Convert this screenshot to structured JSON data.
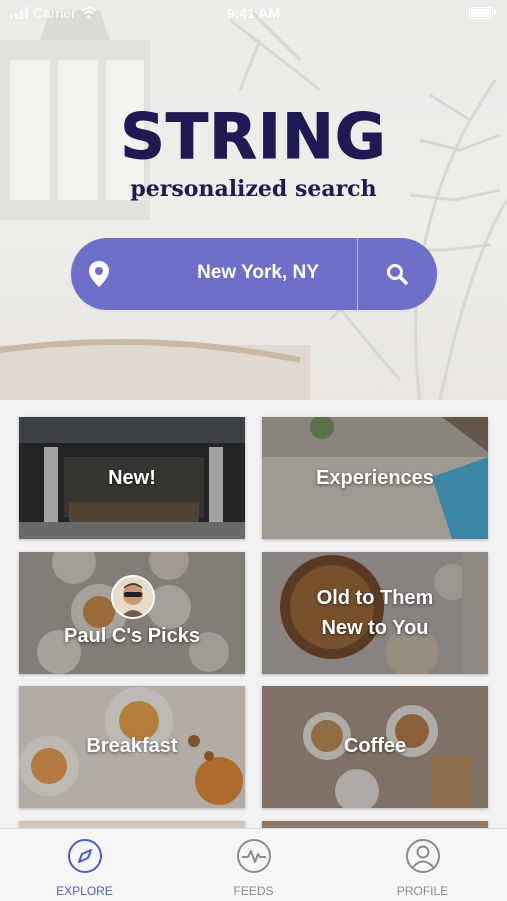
{
  "status_bar": {
    "carrier": "Carrier",
    "time": "9:41 AM"
  },
  "app": {
    "title": "STRING",
    "subtitle": "personalized search"
  },
  "search": {
    "location": "New York, NY",
    "pin_icon": "location-pin-icon",
    "search_icon": "magnifier-icon"
  },
  "colors": {
    "accent": "#6d6fc8",
    "title": "#1f1a52",
    "tab_active": "#4d5bd0",
    "tab_inactive": "#8c8c90"
  },
  "tiles": [
    {
      "label": "New!"
    },
    {
      "label": "Experiences"
    },
    {
      "label": "Paul C's Picks"
    },
    {
      "label_line1": "Old to Them",
      "label_line2": "New to You"
    },
    {
      "label": "Breakfast"
    },
    {
      "label": "Coffee"
    }
  ],
  "tabs": [
    {
      "label": "EXPLORE",
      "icon": "compass-icon",
      "active": true
    },
    {
      "label": "FEEDS",
      "icon": "pulse-icon",
      "active": false
    },
    {
      "label": "PROFILE",
      "icon": "user-icon",
      "active": false
    }
  ]
}
